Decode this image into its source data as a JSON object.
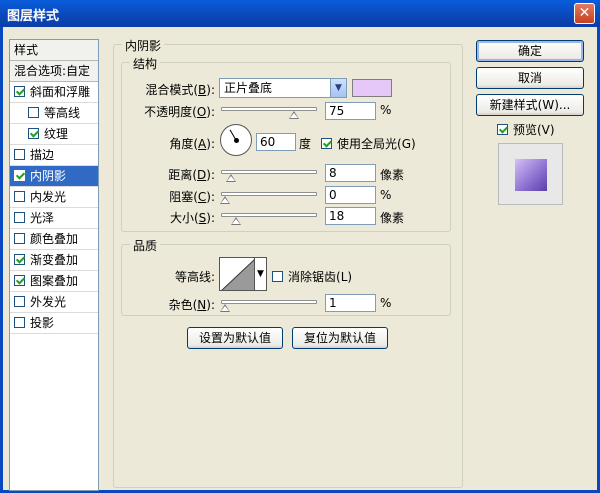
{
  "window": {
    "title": "图层样式",
    "close_glyph": "✕"
  },
  "style_list": {
    "header": "样式",
    "blend_options": "混合选项:自定",
    "items": [
      {
        "label": "斜面和浮雕",
        "checked": true
      },
      {
        "label": "等高线",
        "checked": false
      },
      {
        "label": "纹理",
        "checked": true
      },
      {
        "label": "描边",
        "checked": false
      },
      {
        "label": "内阴影",
        "checked": true,
        "selected": true
      },
      {
        "label": "内发光",
        "checked": false
      },
      {
        "label": "光泽",
        "checked": false
      },
      {
        "label": "颜色叠加",
        "checked": false
      },
      {
        "label": "渐变叠加",
        "checked": true
      },
      {
        "label": "图案叠加",
        "checked": true
      },
      {
        "label": "外发光",
        "checked": false
      },
      {
        "label": "投影",
        "checked": false
      }
    ]
  },
  "inner_shadow": {
    "title": "内阴影",
    "structure": {
      "title": "结构",
      "blend_mode_label": "混合模式(",
      "blend_mode_key": "B",
      "blend_mode_value": "正片叠底",
      "shadow_color": "#e6c8f8",
      "opacity_label": "不透明度(",
      "opacity_key": "O",
      "opacity_value": "75",
      "opacity_unit": "%",
      "opacity_fraction": 0.75,
      "angle_label": "角度(",
      "angle_key": "A",
      "angle_value": "60",
      "angle_unit": "度",
      "global_light_label": "使用全局光(",
      "global_light_key": "G",
      "global_light_checked": true,
      "distance_label": "距离(",
      "distance_key": "D",
      "distance_value": "8",
      "distance_unit": "像素",
      "choke_label": "阻塞(",
      "choke_key": "C",
      "choke_value": "0",
      "choke_unit": "%",
      "size_label": "大小(",
      "size_key": "S",
      "size_value": "18",
      "size_unit": "像素"
    },
    "quality": {
      "title": "品质",
      "contour_label": "等高线:",
      "antialias_label": "消除锯齿(",
      "antialias_key": "L",
      "antialias_checked": false,
      "noise_label": "杂色(",
      "noise_key": "N",
      "noise_value": "1",
      "noise_unit": "%"
    },
    "set_default_label": "设置为默认值",
    "reset_default_label": "复位为默认值"
  },
  "actions": {
    "ok_label": "确定",
    "cancel_label": "取消",
    "new_style_label": "新建样式(W)...",
    "preview_label": "预览(V)",
    "preview_checked": true
  },
  "close_paren": "):"
}
